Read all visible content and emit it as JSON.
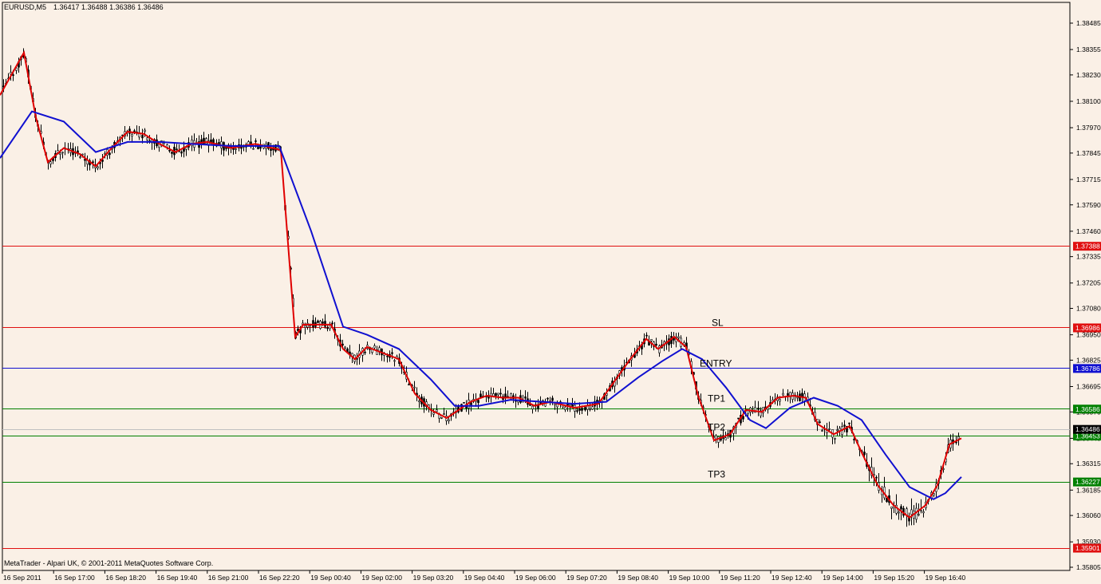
{
  "header": {
    "symbol": "EURUSD,M5",
    "ohlc": "1.36417 1.36488 1.36386 1.36486"
  },
  "footer": {
    "copyright": "MetaTrader - Alpari UK, © 2001-2011 MetaQuotes Software Corp."
  },
  "chart_data": {
    "type": "candlestick",
    "ylim": [
      1.3584,
      1.3853
    ],
    "price_ticks": [
      1.38485,
      1.38355,
      1.3823,
      1.381,
      1.3797,
      1.37845,
      1.37715,
      1.3759,
      1.3746,
      1.37335,
      1.37205,
      1.3708,
      1.3695,
      1.36825,
      1.36695,
      1.3657,
      1.3644,
      1.36315,
      1.36185,
      1.3606,
      1.3593,
      1.35805
    ],
    "time_labels": [
      "16 Sep 2011",
      "16 Sep 17:00",
      "16 Sep 18:20",
      "16 Sep 19:40",
      "16 Sep 21:00",
      "16 Sep 22:20",
      "19 Sep 00:40",
      "19 Sep 02:00",
      "19 Sep 03:20",
      "19 Sep 04:40",
      "19 Sep 06:00",
      "19 Sep 07:20",
      "19 Sep 08:40",
      "19 Sep 10:00",
      "19 Sep 11:20",
      "19 Sep 12:40",
      "19 Sep 14:00",
      "19 Sep 15:20",
      "19 Sep 16:40"
    ],
    "levels": [
      {
        "name": "",
        "price": 1.37388,
        "label": "1.37388",
        "color": "#e01010",
        "text_color": "#ffffff"
      },
      {
        "name": "SL",
        "price": 1.36986,
        "label": "1.36986",
        "color": "#e01010",
        "text_color": "#ffffff"
      },
      {
        "name": "ENTRY",
        "price": 1.36786,
        "label": "1.36786",
        "color": "#1010d0",
        "text_color": "#ffffff"
      },
      {
        "name": "TP1",
        "price": 1.36586,
        "label": "1.36586",
        "color": "#008000",
        "text_color": "#ffffff"
      },
      {
        "name": "TP2",
        "price": 1.36453,
        "label": "1.36453",
        "color": "#008000",
        "text_color": "#ffffff"
      },
      {
        "name": "TP3",
        "price": 1.36227,
        "label": "1.36227",
        "color": "#008000",
        "text_color": "#ffffff"
      },
      {
        "name": "",
        "price": 1.35901,
        "label": "1.35901",
        "color": "#e01010",
        "text_color": "#ffffff"
      }
    ],
    "current_price": {
      "price": 1.36486,
      "label": "1.36486",
      "color": "#000000",
      "text_color": "#ffffff"
    },
    "series": [
      {
        "type": "ma",
        "color": "#e00000",
        "points": [
          [
            0,
            1.3813
          ],
          [
            30,
            1.3834
          ],
          [
            45,
            1.3802
          ],
          [
            60,
            1.378
          ],
          [
            80,
            1.3787
          ],
          [
            100,
            1.3784
          ],
          [
            120,
            1.3778
          ],
          [
            140,
            1.3787
          ],
          [
            160,
            1.3795
          ],
          [
            180,
            1.3794
          ],
          [
            200,
            1.3789
          ],
          [
            220,
            1.3785
          ],
          [
            240,
            1.3789
          ],
          [
            260,
            1.379
          ],
          [
            290,
            1.3787
          ],
          [
            320,
            1.3789
          ],
          [
            352,
            1.3786
          ],
          [
            370,
            1.3694
          ],
          [
            380,
            1.37
          ],
          [
            415,
            1.37
          ],
          [
            430,
            1.3688
          ],
          [
            445,
            1.3683
          ],
          [
            460,
            1.3689
          ],
          [
            480,
            1.3686
          ],
          [
            500,
            1.3683
          ],
          [
            520,
            1.3666
          ],
          [
            540,
            1.3658
          ],
          [
            560,
            1.3654
          ],
          [
            590,
            1.3662
          ],
          [
            610,
            1.3665
          ],
          [
            630,
            1.3664
          ],
          [
            650,
            1.3664
          ],
          [
            670,
            1.366
          ],
          [
            690,
            1.3662
          ],
          [
            720,
            1.3659
          ],
          [
            750,
            1.3661
          ],
          [
            770,
            1.3672
          ],
          [
            790,
            1.3683
          ],
          [
            810,
            1.3693
          ],
          [
            825,
            1.3688
          ],
          [
            845,
            1.3694
          ],
          [
            860,
            1.3689
          ],
          [
            875,
            1.3665
          ],
          [
            895,
            1.3643
          ],
          [
            915,
            1.3646
          ],
          [
            935,
            1.3658
          ],
          [
            955,
            1.3657
          ],
          [
            975,
            1.3664
          ],
          [
            995,
            1.3665
          ],
          [
            1010,
            1.3664
          ],
          [
            1025,
            1.3651
          ],
          [
            1045,
            1.3646
          ],
          [
            1065,
            1.365
          ],
          [
            1080,
            1.3637
          ],
          [
            1100,
            1.3621
          ],
          [
            1120,
            1.3611
          ],
          [
            1140,
            1.3605
          ],
          [
            1160,
            1.3611
          ],
          [
            1175,
            1.3621
          ],
          [
            1190,
            1.3641
          ],
          [
            1205,
            1.3644
          ]
        ]
      },
      {
        "type": "ma",
        "color": "#1010d0",
        "points": [
          [
            0,
            1.3782
          ],
          [
            40,
            1.3805
          ],
          [
            80,
            1.38
          ],
          [
            120,
            1.3785
          ],
          [
            160,
            1.379
          ],
          [
            200,
            1.379
          ],
          [
            240,
            1.3789
          ],
          [
            290,
            1.3788
          ],
          [
            330,
            1.3788
          ],
          [
            350,
            1.3788
          ],
          [
            390,
            1.3746
          ],
          [
            430,
            1.3699
          ],
          [
            460,
            1.3695
          ],
          [
            500,
            1.3688
          ],
          [
            540,
            1.3673
          ],
          [
            570,
            1.366
          ],
          [
            600,
            1.366
          ],
          [
            640,
            1.3663
          ],
          [
            680,
            1.3662
          ],
          [
            720,
            1.3661
          ],
          [
            760,
            1.3662
          ],
          [
            800,
            1.3674
          ],
          [
            830,
            1.3682
          ],
          [
            855,
            1.3688
          ],
          [
            880,
            1.3683
          ],
          [
            910,
            1.3669
          ],
          [
            940,
            1.3653
          ],
          [
            960,
            1.3649
          ],
          [
            990,
            1.3659
          ],
          [
            1020,
            1.3664
          ],
          [
            1050,
            1.366
          ],
          [
            1080,
            1.3653
          ],
          [
            1110,
            1.3636
          ],
          [
            1140,
            1.362
          ],
          [
            1170,
            1.3614
          ],
          [
            1185,
            1.3617
          ],
          [
            1205,
            1.3625
          ]
        ]
      }
    ]
  }
}
